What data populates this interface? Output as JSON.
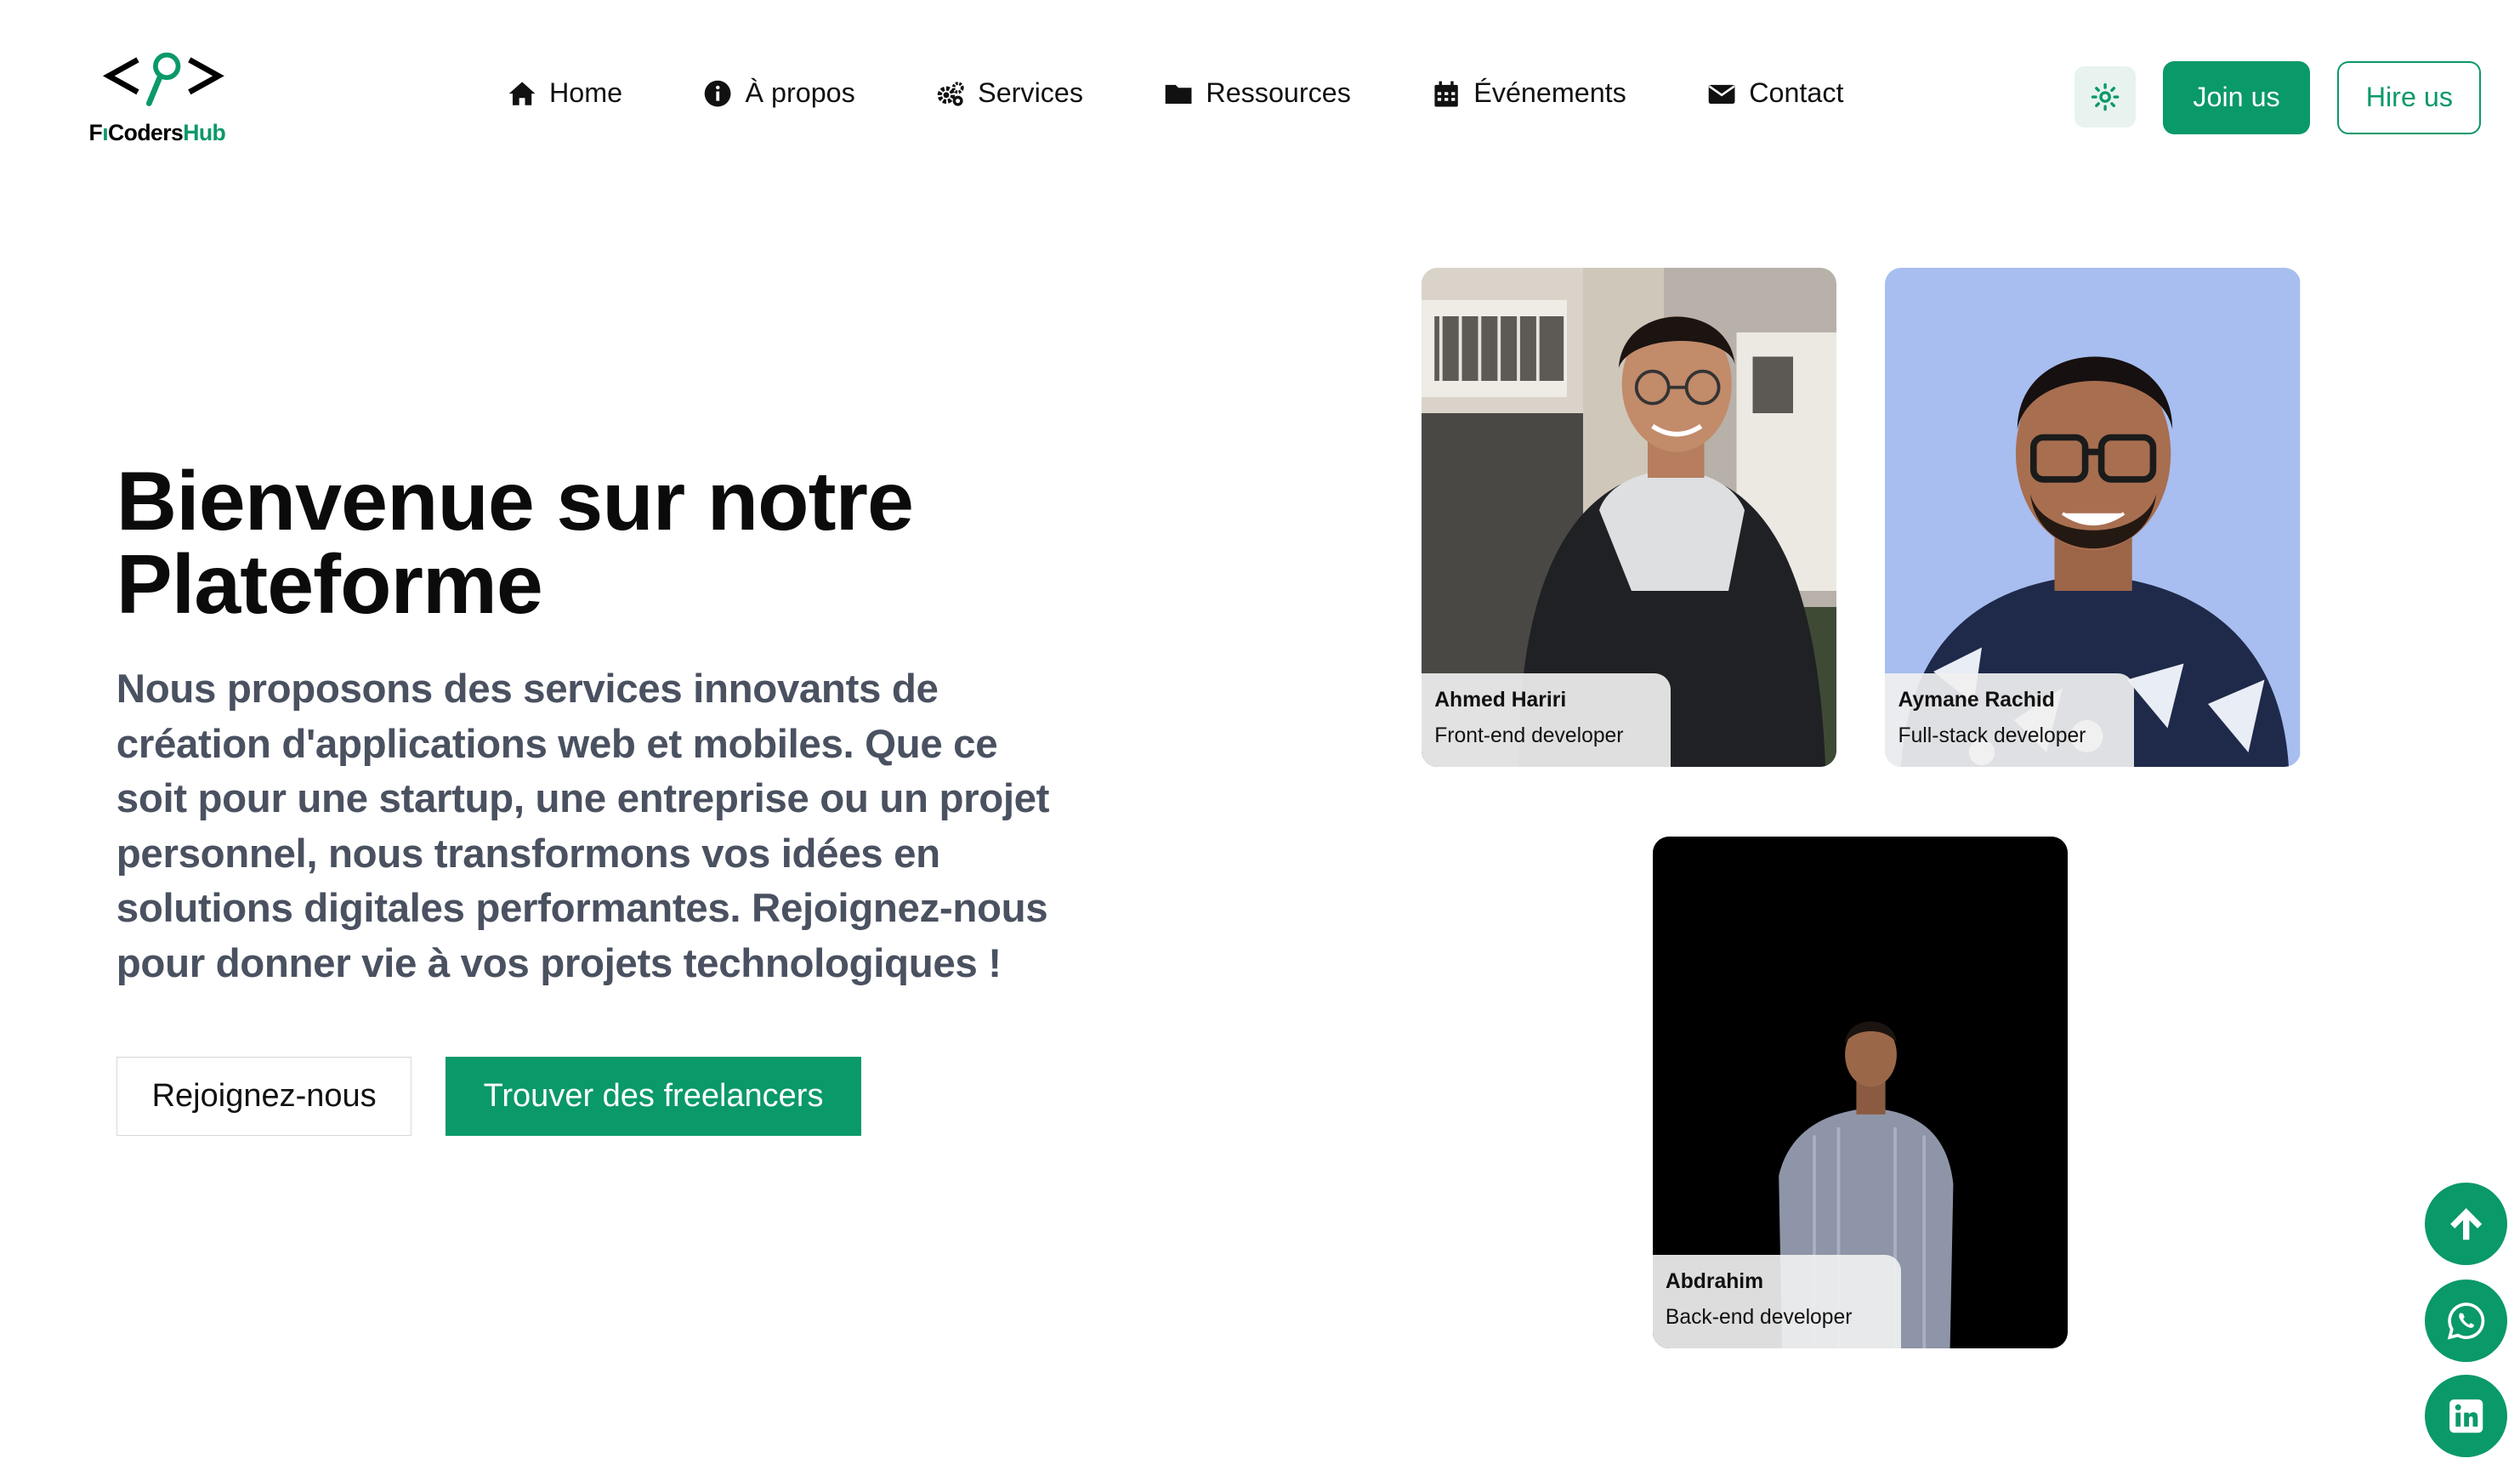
{
  "brand": {
    "logo_icon": "code-magnifier-logo",
    "name_prefix": "F",
    "name_middle": "Coders",
    "name_suffix": "Hub",
    "accent_color": "#0a9968"
  },
  "nav": {
    "items": [
      {
        "label": "Home",
        "icon": "home-icon"
      },
      {
        "label": "À propos",
        "icon": "info-icon"
      },
      {
        "label": "Services",
        "icon": "cogs-icon"
      },
      {
        "label": "Ressources",
        "icon": "folder-icon"
      },
      {
        "label": "Événements",
        "icon": "calendar-icon"
      },
      {
        "label": "Contact",
        "icon": "envelope-icon"
      }
    ]
  },
  "header": {
    "theme_toggle_icon": "sun-icon",
    "join_label": "Join us",
    "hire_label": "Hire us"
  },
  "hero": {
    "title": "Bienvenue sur notre Plateforme",
    "description": "Nous proposons des services innovants de création d'applications web et mobiles. Que ce soit pour une startup, une entreprise ou un projet personnel, nous transformons vos idées en solutions digitales performantes. Rejoignez-nous pour donner vie à vos projets technologiques !",
    "primary_button": "Rejoignez-nous",
    "secondary_button": "Trouver des freelancers"
  },
  "team": [
    {
      "name": "Ahmed Hariri",
      "role": "Front-end developer"
    },
    {
      "name": "Aymane Rachid",
      "role": "Full-stack developer"
    },
    {
      "name": "Abdrahim",
      "role": "Back-end developer"
    }
  ],
  "floating": {
    "scroll_top_icon": "arrow-up-icon",
    "whatsapp_icon": "whatsapp-icon",
    "linkedin_icon": "linkedin-icon"
  }
}
